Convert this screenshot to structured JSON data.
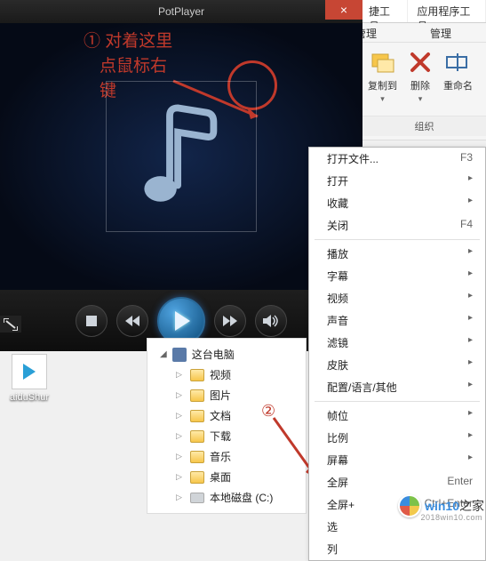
{
  "potplayer": {
    "title": "PotPlayer",
    "close": "×"
  },
  "annotations": {
    "a1_line1": "① 对着这里",
    "a1_line2": "点鼠标右",
    "a1_line3": "键",
    "a2": "②"
  },
  "ribbon": {
    "tab_tools": "捷工具",
    "tab_apps": "应用程序工具",
    "sub_manage1": "管理",
    "sub_manage2": "管理",
    "copy_to": "复制到",
    "delete": "删除",
    "rename": "重命名",
    "group": "组织"
  },
  "tree": {
    "root": "这台电脑",
    "items": [
      "视频",
      "图片",
      "文档",
      "下载",
      "音乐",
      "桌面",
      "本地磁盘 (C:)"
    ]
  },
  "context_menu": {
    "groups": [
      [
        {
          "label": "打开文件...",
          "shortcut": "F3",
          "sub": false
        },
        {
          "label": "打开",
          "shortcut": "",
          "sub": true
        },
        {
          "label": "收藏",
          "shortcut": "",
          "sub": true
        },
        {
          "label": "关闭",
          "shortcut": "F4",
          "sub": false
        }
      ],
      [
        {
          "label": "播放",
          "shortcut": "",
          "sub": true
        },
        {
          "label": "字幕",
          "shortcut": "",
          "sub": true
        },
        {
          "label": "视频",
          "shortcut": "",
          "sub": true
        },
        {
          "label": "声音",
          "shortcut": "",
          "sub": true
        },
        {
          "label": "滤镜",
          "shortcut": "",
          "sub": true
        },
        {
          "label": "皮肤",
          "shortcut": "",
          "sub": true
        },
        {
          "label": "配置/语言/其他",
          "shortcut": "",
          "sub": true
        }
      ],
      [
        {
          "label": "帧位",
          "shortcut": "",
          "sub": true
        },
        {
          "label": "比例",
          "shortcut": "",
          "sub": true
        },
        {
          "label": "屏幕",
          "shortcut": "",
          "sub": true
        },
        {
          "label": "全屏",
          "shortcut": "Enter",
          "sub": false
        },
        {
          "label": "全屏+",
          "shortcut": "Ctrl+Enter",
          "sub": false
        },
        {
          "label": "选",
          "shortcut": "",
          "sub": false
        },
        {
          "label": "列",
          "shortcut": "",
          "sub": false
        }
      ]
    ]
  },
  "desktop": {
    "label": "aiduShur"
  },
  "watermark": {
    "brand_a": "win10",
    "brand_b": "之家",
    "sub": "2018win10.com"
  }
}
